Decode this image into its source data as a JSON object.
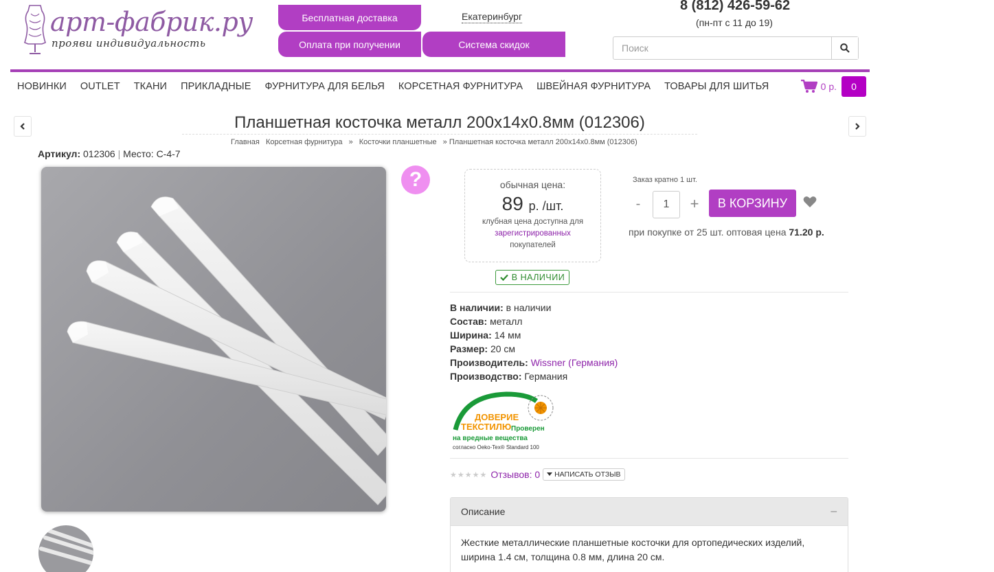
{
  "header": {
    "logo_text": "арт-фабрик.ру",
    "logo_slogan": "прояви индивидуальность",
    "promo": {
      "free_delivery": "Бесплатная доставка",
      "cash_on_delivery": "Оплата при получении",
      "discounts": "Система скидок"
    },
    "city": "Екатеринбург",
    "phone": "8 (812) 426-59-62",
    "hours": "(пн-пт с 11 до 19)",
    "search_placeholder": "Поиск"
  },
  "nav": {
    "items": [
      "НОВИНКИ",
      "OUTLET",
      "ТКАНИ",
      "ПРИКЛАДНЫЕ",
      "ФУРНИТУРА ДЛЯ БЕЛЬЯ",
      "КОРСЕТНАЯ ФУРНИТУРА",
      "ШВЕЙНАЯ ФУРНИТУРА",
      "ТОВАРЫ ДЛЯ ШИТЬЯ"
    ],
    "cart_sum": "0 р.",
    "cart_count": "0"
  },
  "product": {
    "title": "Планшетная косточка металл 200х14х0.8мм (012306)",
    "breadcrumb": [
      "Главная",
      "Корсетная фурнитура",
      "Косточки планшетные",
      "» Планшетная косточка металл 200х14х0.8мм (012306)"
    ],
    "breadcrumb_sep": "»",
    "sku_label": "Артикул:",
    "sku": "012306",
    "place": "Место: С-4-7",
    "price_label": "обычная цена:",
    "price": "89",
    "price_unit": "р. /шт.",
    "club_text_1": "клубная цена доступна для",
    "club_link": "зарегистрированных",
    "club_text_2": "покупателей",
    "stock_badge": "В НАЛИЧИИ",
    "order_multiple": "Заказ кратно 1 шт.",
    "qty": "1",
    "minus": "-",
    "plus": "+",
    "to_cart": "В КОРЗИНУ",
    "wholesale_text": "при покупке от 25 шт. оптовая цена",
    "wholesale_price": "71.20 р.",
    "props": [
      {
        "label": "В наличии:",
        "value": "в наличии"
      },
      {
        "label": "Состав:",
        "value": "металл"
      },
      {
        "label": "Ширина:",
        "value": "14 мм"
      },
      {
        "label": "Размер:",
        "value": "20 см"
      },
      {
        "label": "Производитель:",
        "value": "Wissner (Германия)"
      },
      {
        "label": "Производство:",
        "value": "Германия"
      }
    ],
    "oeko": {
      "line1": "ДОВЕРИЕ",
      "line2": "ТЕКСТИЛЮ",
      "checked": "Проверен",
      "line3": "на вредные вещества",
      "line4": "согласно Oeko-Tex® Standard 100"
    },
    "stars": "★★★★★",
    "reviews": "Отзывов: 0",
    "write_review": "НАПИСАТЬ ОТЗЫВ",
    "desc_title": "Описание",
    "desc_toggle": "−",
    "description": "Жесткие металлические планшетные косточки для ортопедических изделий, ширина 1.4 см, толщина 0.8 мм, длина 20 см."
  },
  "colors": {
    "brand": "#b13ec3",
    "link": "#8e24aa",
    "stock": "#2e8b2e",
    "help": "#ef8ff0"
  }
}
